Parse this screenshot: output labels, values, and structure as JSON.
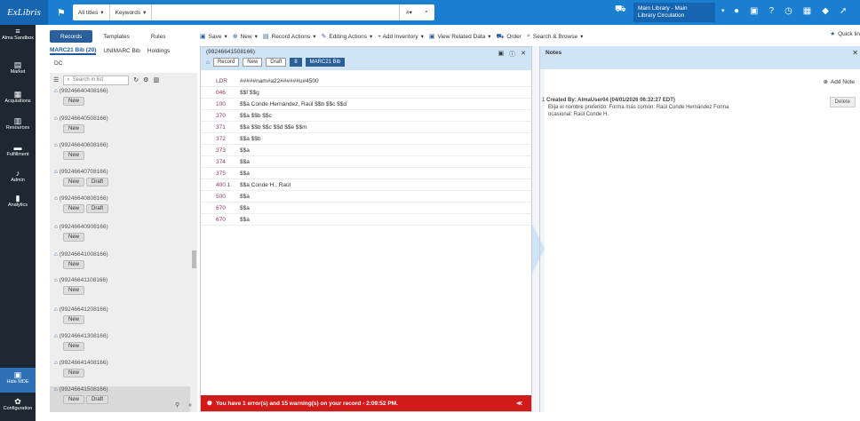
{
  "topbar": {
    "logo": "ExLibris",
    "search_scope": "All titles",
    "search_field": "Keywords",
    "library_line1": "Main Library - Main",
    "library_line2": "Library Circulation"
  },
  "leftnav": [
    {
      "label": "Alma Sandbox",
      "glyph": "≡"
    },
    {
      "label": "Market",
      "glyph": "▤"
    },
    {
      "label": "Acquisitions",
      "glyph": "▦"
    },
    {
      "label": "Resources",
      "glyph": "▥"
    },
    {
      "label": "Fulfillment",
      "glyph": "▬"
    },
    {
      "label": "Admin",
      "glyph": "♪"
    },
    {
      "label": "Analytics",
      "glyph": "▮"
    },
    {
      "label": "Hide MDE",
      "glyph": "▣"
    },
    {
      "label": "Configuration",
      "glyph": "✿"
    }
  ],
  "left_panel": {
    "tabs": [
      "Records",
      "Templates",
      "Rules"
    ],
    "subtabs": [
      "MARC21 Bib (20)",
      "UNIMARC Bib",
      "Holdings"
    ],
    "dc": "DC",
    "search_placeholder": "Search in list",
    "records": [
      {
        "id": "(99246640408166)",
        "pills": [
          "New"
        ]
      },
      {
        "id": "(99246640508166)",
        "pills": [
          "New"
        ]
      },
      {
        "id": "(99246640608166)",
        "pills": [
          "New"
        ]
      },
      {
        "id": "(99246640708166)",
        "pills": [
          "New",
          "Draft"
        ]
      },
      {
        "id": "(99246640808166)",
        "pills": [
          "New",
          "Draft"
        ]
      },
      {
        "id": "(99246640908166)",
        "pills": [
          "New"
        ]
      },
      {
        "id": "(99246641008166)",
        "pills": [
          "New"
        ]
      },
      {
        "id": "(99246641108166)",
        "pills": [
          "New"
        ]
      },
      {
        "id": "(99246641208166)",
        "pills": [
          "New"
        ]
      },
      {
        "id": "(99246641308166)",
        "pills": [
          "New"
        ]
      },
      {
        "id": "(99246641408166)",
        "pills": [
          "New"
        ]
      },
      {
        "id": "(99246641508166)",
        "pills": [
          "New",
          "Draft"
        ]
      }
    ]
  },
  "toolbar": {
    "save": "Save",
    "new": "New",
    "record_actions": "Record Actions",
    "editing_actions": "Editing Actions",
    "add_inventory": "+ Add Inventory",
    "view_related": "View Related Data",
    "order": "Order",
    "search_browse": "Search & Browse",
    "quick": "Quick lin"
  },
  "editor": {
    "record_id": "(99246641508166)",
    "tags": [
      "Record",
      "New",
      "Draft",
      "8",
      "MARC21 Bib"
    ],
    "fields": [
      {
        "tag": "LDR",
        "value": "#####nam#a22######u#4500"
      },
      {
        "tag": "046",
        "value": "$$f $$g"
      },
      {
        "tag": "100",
        "value": "$$a Conde Hernández, Raúl $$b $$c $$d"
      },
      {
        "tag": "370",
        "value": "$$a $$b $$c"
      },
      {
        "tag": "371",
        "value": "$$a $$b $$c $$d $$e $$m"
      },
      {
        "tag": "372",
        "value": "$$a $$b"
      },
      {
        "tag": "373",
        "value": "$$a"
      },
      {
        "tag": "374",
        "value": "$$a"
      },
      {
        "tag": "375",
        "value": "$$a"
      },
      {
        "tag": "400 1",
        "value": "$$a Conde H., Raúl"
      },
      {
        "tag": "500",
        "value": "$$a"
      },
      {
        "tag": "670",
        "value": "$$a"
      },
      {
        "tag": "670",
        "value": "$$a"
      }
    ],
    "error": "You have 1 error(s) and 15 warning(s) on your record - 2:09:52 PM."
  },
  "notes": {
    "title": "Notes",
    "add": "Add Note",
    "num": "1",
    "created": "Created By: AlmaUser04 (04/01/2026 06:32:27 EDT)",
    "text1": "Elija el nombre preferido: Forma más común: Raúl Conde Hernández Forma",
    "text2": "ocasional: Raúl Conde H.",
    "delete": "Delete"
  }
}
